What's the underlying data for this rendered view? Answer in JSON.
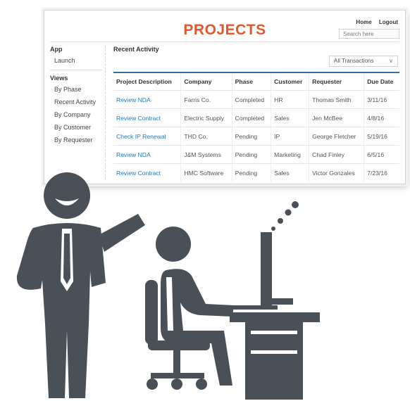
{
  "header": {
    "title": "PROJECTS",
    "home_label": "Home",
    "logout_label": "Logout",
    "search_placeholder": "Search here"
  },
  "sidebar": {
    "app_heading": "App",
    "app_items": [
      "Launch"
    ],
    "views_heading": "Views",
    "view_items": [
      "By Phase",
      "Recent Activity",
      "By Company",
      "By Customer",
      "By Requester"
    ]
  },
  "main": {
    "section_title": "Recent Activity",
    "filter_value": "All Transactions",
    "columns": [
      "Project Description",
      "Company",
      "Phase",
      "Customer",
      "Requester",
      "Due Date"
    ],
    "rows": [
      [
        "Review NDA",
        "Farris Co.",
        "Completed",
        "HR",
        "Thomas Smith",
        "3/11/16"
      ],
      [
        "Review Contract",
        "Electric Supply",
        "Completed",
        "Sales",
        "Jen McBee",
        "4/8/16"
      ],
      [
        "Check IP Renewal",
        "THD Co.",
        "Pending",
        "IP",
        "George Fletcher",
        "5/19/16"
      ],
      [
        "Review NDA",
        "J&M Systems",
        "Pending",
        "Marketing",
        "Chad Finley",
        "6/5/16"
      ],
      [
        "Review Contract",
        "HMC Software",
        "Pending",
        "Sales",
        "Victor Gonzales",
        "7/23/16"
      ]
    ]
  },
  "colors": {
    "title": "#e0582b",
    "link": "#2677c2",
    "table_rule": "#2f6fa8",
    "figure": "#4a5058"
  },
  "icons": {
    "filter_chevron": "chevron-down-icon"
  }
}
